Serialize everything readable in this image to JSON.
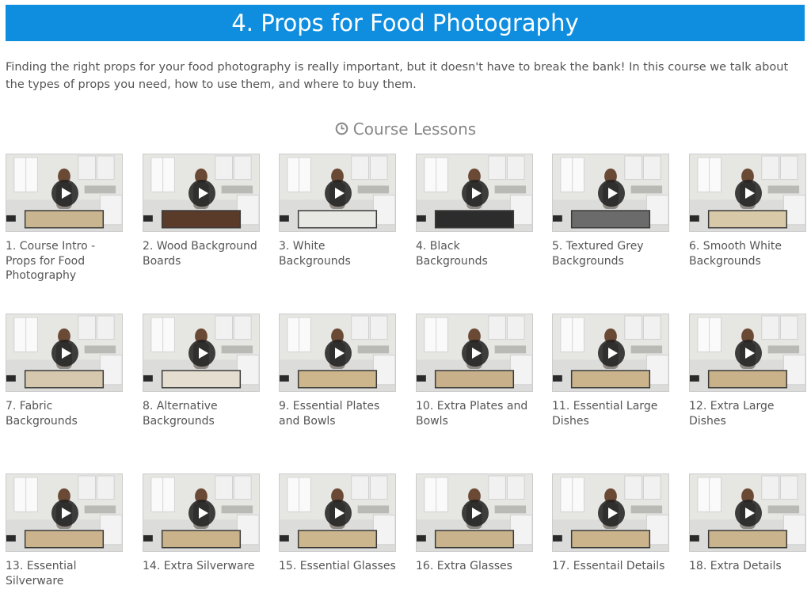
{
  "page": {
    "title": "4. Props for Food Photography",
    "intro": "Finding the right props for your food photography is really important, but it doesn't have to break the bank! In this course we talk about the types of props you need, how to use them, and where to buy them.",
    "lessons_heading": "Course Lessons"
  },
  "colors": {
    "accent": "#0f8ee0"
  },
  "lessons": [
    {
      "label": "1. Course Intro - Props for Food Photography",
      "board": "#c9b58f"
    },
    {
      "label": "2. Wood Background Boards",
      "board": "#5a3a28"
    },
    {
      "label": "3. White Backgrounds",
      "board": "#e8e8e4"
    },
    {
      "label": "4. Black Backgrounds",
      "board": "#2c2c2c"
    },
    {
      "label": "5. Textured Grey Backgrounds",
      "board": "#6b6b6b"
    },
    {
      "label": "6. Smooth White Backgrounds",
      "board": "#d8c9a8"
    },
    {
      "label": "7. Fabric Backgrounds",
      "board": "#d6c8ae"
    },
    {
      "label": "8. Alternative Backgrounds",
      "board": "#e4ddd0"
    },
    {
      "label": "9. Essential Plates and Bowls",
      "board": "#cdb68b"
    },
    {
      "label": "10. Extra Plates and Bowls",
      "board": "#c7b08a"
    },
    {
      "label": "11. Essential Large Dishes",
      "board": "#cbb48c"
    },
    {
      "label": "12. Extra Large Dishes",
      "board": "#c9b28a"
    },
    {
      "label": "13. Essential Silverware",
      "board": "#cbb48d"
    },
    {
      "label": "14. Extra Silverware",
      "board": "#cab38b"
    },
    {
      "label": "15. Essential Glasses",
      "board": "#ccb68e"
    },
    {
      "label": "16. Extra Glasses",
      "board": "#c9b38c"
    },
    {
      "label": "17. Essentail Details",
      "board": "#cbb48b"
    },
    {
      "label": "18. Extra Details",
      "board": "#cab48d"
    }
  ]
}
